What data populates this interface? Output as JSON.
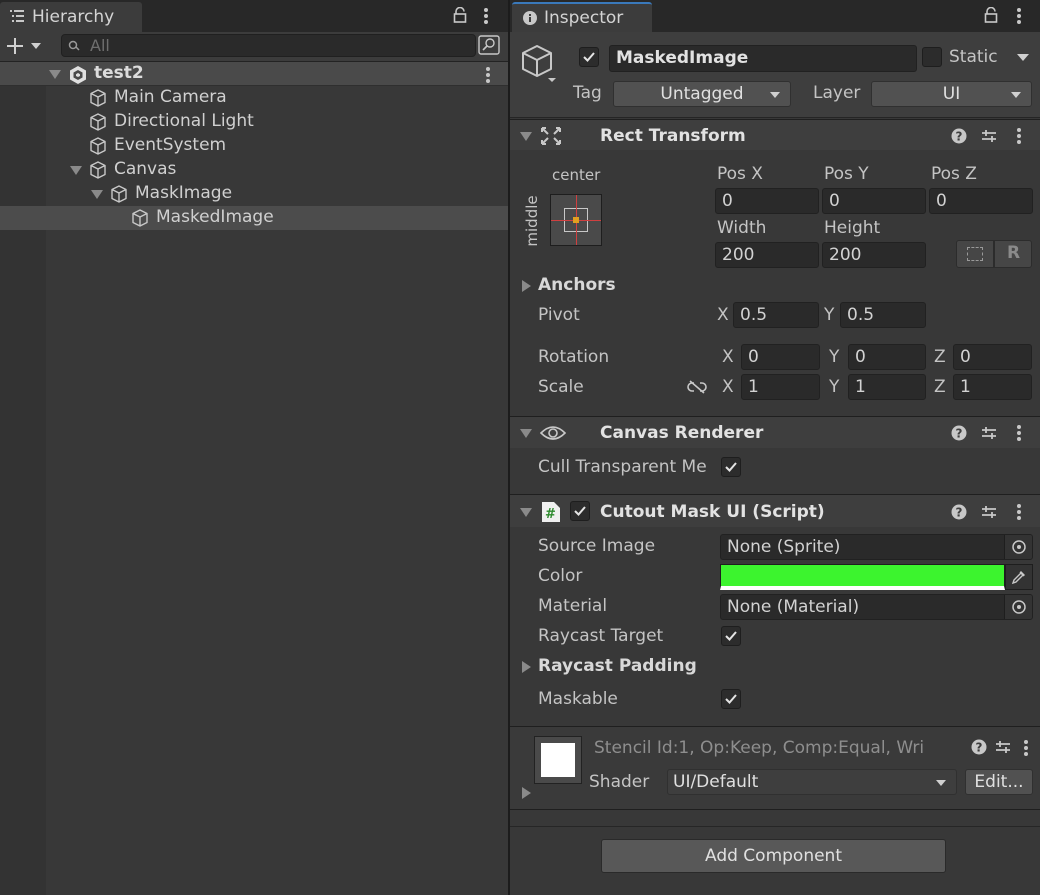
{
  "hierarchy": {
    "tab_label": "Hierarchy",
    "search_placeholder": "All",
    "scene_name": "test2",
    "items": [
      {
        "label": "Main Camera"
      },
      {
        "label": "Directional Light"
      },
      {
        "label": "EventSystem"
      },
      {
        "label": "Canvas"
      },
      {
        "label": "MaskImage"
      },
      {
        "label": "MaskedImage"
      }
    ]
  },
  "inspector": {
    "tab_label": "Inspector",
    "object_name": "MaskedImage",
    "static_label": "Static",
    "tag_label": "Tag",
    "tag_value": "Untagged",
    "layer_label": "Layer",
    "layer_value": "UI",
    "rect_transform": {
      "title": "Rect Transform",
      "anchor_h": "center",
      "anchor_v": "middle",
      "pos_x_label": "Pos X",
      "pos_x": "0",
      "pos_y_label": "Pos Y",
      "pos_y": "0",
      "pos_z_label": "Pos Z",
      "pos_z": "0",
      "width_label": "Width",
      "width": "200",
      "height_label": "Height",
      "height": "200",
      "r_button": "R",
      "anchors_label": "Anchors",
      "pivot_label": "Pivot",
      "pivot_x": "0.5",
      "pivot_y": "0.5",
      "rotation_label": "Rotation",
      "rot_x": "0",
      "rot_y": "0",
      "rot_z": "0",
      "scale_label": "Scale",
      "scale_x": "1",
      "scale_y": "1",
      "scale_z": "1",
      "x_axis": "X",
      "y_axis": "Y",
      "z_axis": "Z"
    },
    "canvas_renderer": {
      "title": "Canvas Renderer",
      "cull_label": "Cull Transparent Me"
    },
    "cutout_mask": {
      "title": "Cutout Mask UI (Script)",
      "source_image_label": "Source Image",
      "source_image_value": "None (Sprite)",
      "color_label": "Color",
      "color_value": "#3cf42e",
      "material_label": "Material",
      "material_value": "None (Material)",
      "raycast_target_label": "Raycast Target",
      "raycast_padding_label": "Raycast Padding",
      "maskable_label": "Maskable"
    },
    "material_block": {
      "stencil_text": "Stencil Id:1, Op:Keep, Comp:Equal, Wri",
      "shader_label": "Shader",
      "shader_value": "UI/Default",
      "edit_button": "Edit..."
    },
    "add_component": "Add Component"
  }
}
